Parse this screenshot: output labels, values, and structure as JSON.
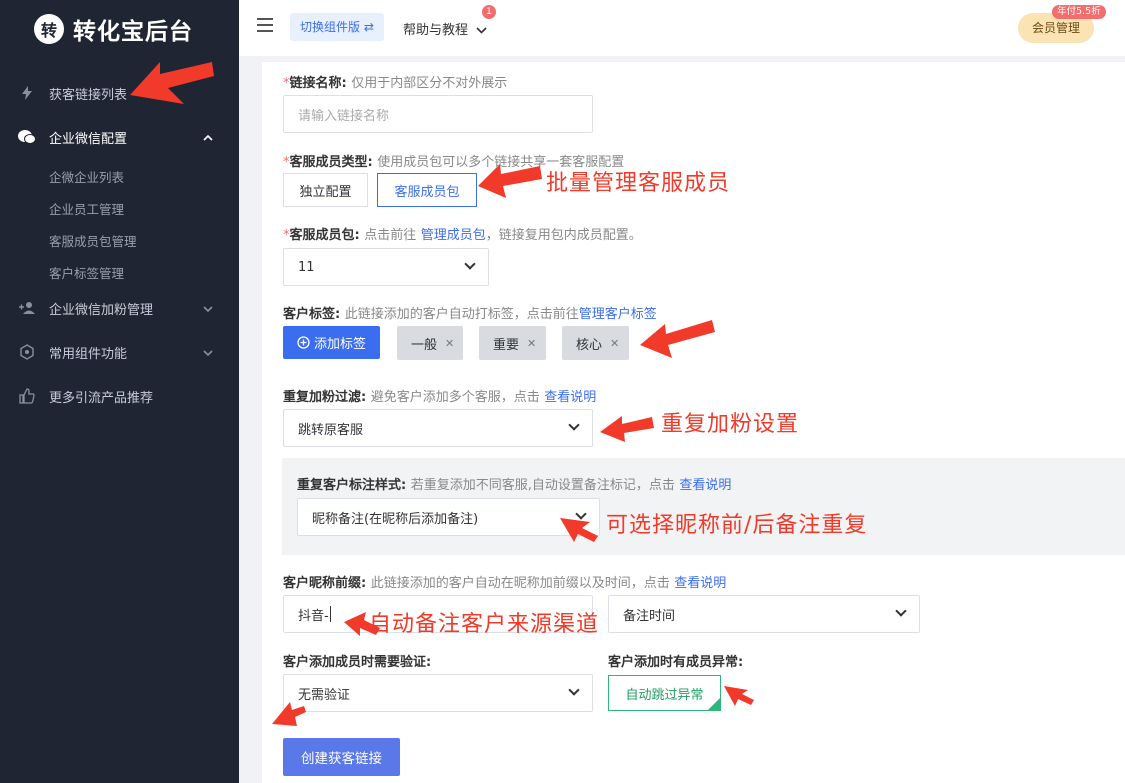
{
  "sidebar": {
    "logo_char": "转",
    "brand": "转化宝后台",
    "items": [
      {
        "label": "获客链接列表"
      },
      {
        "label": "企业微信配置"
      },
      {
        "label": "企业微信加粉管理"
      },
      {
        "label": "常用组件功能"
      },
      {
        "label": "更多引流产品推荐"
      }
    ],
    "sub_items": [
      "企微企业列表",
      "企业员工管理",
      "客服成员包管理",
      "客户标签管理"
    ]
  },
  "header": {
    "switch_label": "切换组件版 ⇄",
    "help_label": "帮助与教程",
    "help_badge": "1",
    "member_label": "会员管理",
    "member_tag": "年付5.5折"
  },
  "form": {
    "link_name": {
      "required": "*",
      "label": "链接名称:",
      "hint": "仅用于内部区分不对外展示",
      "placeholder": "请输入链接名称"
    },
    "member_type": {
      "required": "*",
      "label": "客服成员类型:",
      "hint": "使用成员包可以多个链接共享一套客服配置",
      "option1": "独立配置",
      "option2": "客服成员包"
    },
    "member_pkg": {
      "required": "*",
      "label": "客服成员包:",
      "hint_pre": "点击前往",
      "link": "管理成员包",
      "hint_post": "，链接复用包内成员配置。",
      "value": "11"
    },
    "tags": {
      "label": "客户标签:",
      "hint": "此链接添加的客户自动打标签，点击前往",
      "link": "管理客户标签",
      "add_label": "添加标签",
      "items": [
        "一般",
        "重要",
        "核心"
      ]
    },
    "dup_filter": {
      "label": "重复加粉过滤:",
      "hint": "避免客户添加多个客服，点击",
      "link": "查看说明",
      "value": "跳转原客服"
    },
    "dup_mark": {
      "label": "重复客户标注样式:",
      "hint": "若重复添加不同客服,自动设置备注标记，点击",
      "link": "查看说明",
      "value": "昵称备注(在昵称后添加备注)"
    },
    "nickname": {
      "label": "客户昵称前缀:",
      "hint": "此链接添加的客户自动在昵称加前缀以及时间，点击",
      "link": "查看说明",
      "prefix_value": "抖音-",
      "time_value": "备注时间"
    },
    "verify": {
      "label": "客户添加成员时需要验证:",
      "value": "无需验证"
    },
    "abnormal": {
      "label": "客户添加时有成员异常:",
      "value": "自动跳过异常"
    },
    "create_label": "创建获客链接"
  },
  "annotations": {
    "a1": "批量管理客服成员",
    "a2": "重复加粉设置",
    "a3": "可选择昵称前/后备注重复",
    "a4": "自动备注客户来源渠道"
  },
  "colors": {
    "sidebar_bg": "#1f2532",
    "primary": "#3a6df0",
    "annotation": "#f23a2a",
    "success": "#2fb67c"
  }
}
